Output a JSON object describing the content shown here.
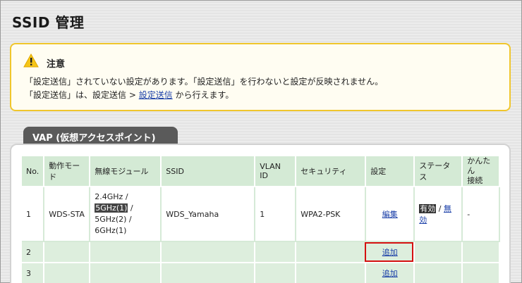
{
  "page": {
    "title": "SSID 管理"
  },
  "notice": {
    "icon": "warning-icon",
    "title": "注意",
    "line1": "「設定送信」されていない設定があります。「設定送信」を行わないと設定が反映されません。",
    "line2_before": "「設定送信」は、設定送信 > ",
    "line2_link": "設定送信",
    "line2_after": " から行えます。"
  },
  "vap": {
    "tab_label": "VAP (仮想アクセスポイント)",
    "headers": [
      "No.",
      "動作モード",
      "無線モジュール",
      "SSID",
      "VLAN ID",
      "セキュリティ",
      "設定",
      "ステータス",
      "かんたん接続"
    ],
    "header_easy_line1": "かんたん",
    "header_easy_line2": "接続",
    "row1": {
      "no": "1",
      "mode": "WDS-STA",
      "band1": "2.4GHz /",
      "band2": "5GHz(1)",
      "band2_suffix": " /",
      "band3": "5GHz(2) /",
      "band4": "6GHz(1)",
      "ssid": "WDS_Yamaha",
      "vlan": "1",
      "security": "WPA2-PSK",
      "setting": "編集",
      "status_on": "有効",
      "status_sep": " / ",
      "status_off": "無効",
      "easy": "-"
    },
    "row2": {
      "no": "2",
      "setting": "追加"
    },
    "row3": {
      "no": "3",
      "setting": "追加"
    }
  },
  "colors": {
    "header_bg": "#d4ead5",
    "row_bg": "#ddeedd",
    "notice_border": "#f0c62c",
    "highlight": "#d41010"
  }
}
